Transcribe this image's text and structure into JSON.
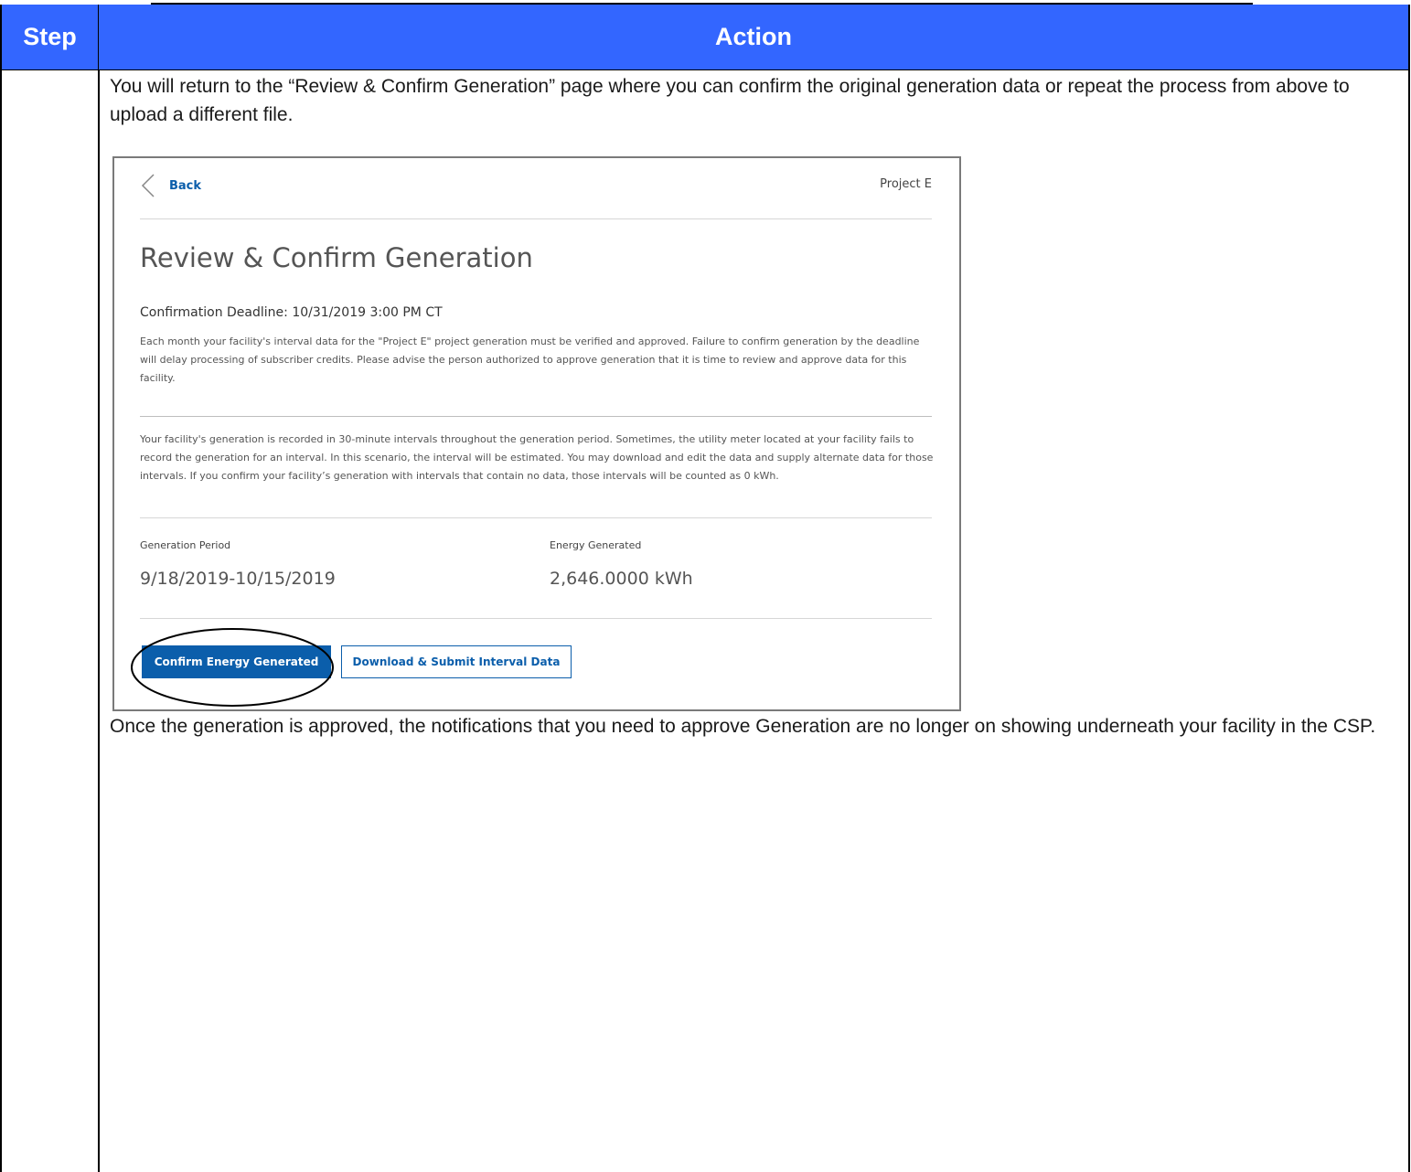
{
  "table": {
    "header": {
      "step": "Step",
      "action": "Action"
    },
    "intro_text": "You will return to the “Review & Confirm Generation” page where you can confirm the original generation data or repeat the process from above to upload a different file.",
    "outro_text": "Once the generation is approved, the notifications that you need to approve Generation are no longer on showing underneath your facility in the CSP."
  },
  "screenshot": {
    "back_label": "Back",
    "project_name": "Project E",
    "title": "Review & Confirm Generation",
    "deadline": "Confirmation Deadline: 10/31/2019 3:00 PM CT",
    "description_1": "Each month your facility's interval data for the \"Project E\" project generation must be verified and approved. Failure to confirm generation by the deadline will delay processing of subscriber credits. Please advise the person authorized to approve generation that it is time to review and approve data for this facility.",
    "description_2": "Your facility's generation is recorded in 30-minute intervals throughout the generation period. Sometimes, the utility meter located at your facility fails to record the generation for an interval. In this scenario, the interval will be estimated. You may download and edit the data and supply alternate data for those intervals. If you confirm your facility’s generation with intervals that contain no data, those intervals will be counted as 0 kWh.",
    "generation_period_label": "Generation Period",
    "generation_period_value": "9/18/2019-10/15/2019",
    "energy_generated_label": "Energy Generated",
    "energy_generated_value": "2,646.0000 kWh",
    "confirm_button": "Confirm Energy Generated",
    "download_button": "Download & Submit Interval Data"
  },
  "colors": {
    "header_bg": "#3366ff",
    "button_primary": "#0b5eab"
  }
}
